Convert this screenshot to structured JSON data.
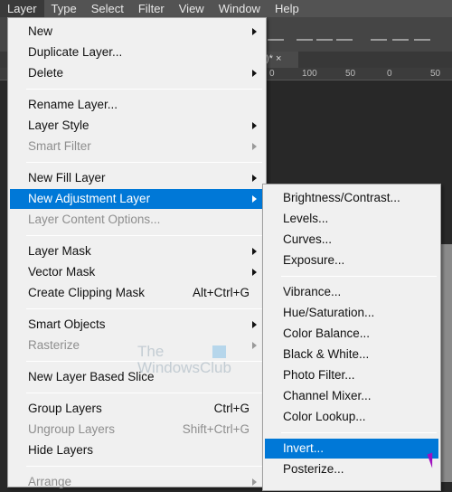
{
  "menubar": [
    "Layer",
    "Type",
    "Select",
    "Filter",
    "View",
    "Window",
    "Help"
  ],
  "document_tab": {
    "label": ")*",
    "close": "×"
  },
  "ruler": [
    "0",
    "100",
    "50",
    "0",
    "50"
  ],
  "main_menu": [
    {
      "label": "New",
      "arrow": true
    },
    {
      "label": "Duplicate Layer..."
    },
    {
      "label": "Delete",
      "arrow": true
    },
    {
      "sep": true
    },
    {
      "label": "Rename Layer..."
    },
    {
      "label": "Layer Style",
      "arrow": true
    },
    {
      "label": "Smart Filter",
      "arrow": true,
      "disabled": true
    },
    {
      "sep": true
    },
    {
      "label": "New Fill Layer",
      "arrow": true
    },
    {
      "label": "New Adjustment Layer",
      "arrow": true,
      "highlighted": true
    },
    {
      "label": "Layer Content Options...",
      "disabled": true
    },
    {
      "sep": true
    },
    {
      "label": "Layer Mask",
      "arrow": true
    },
    {
      "label": "Vector Mask",
      "arrow": true
    },
    {
      "label": "Create Clipping Mask",
      "shortcut": "Alt+Ctrl+G"
    },
    {
      "sep": true
    },
    {
      "label": "Smart Objects",
      "arrow": true
    },
    {
      "label": "Rasterize",
      "arrow": true,
      "disabled": true
    },
    {
      "sep": true
    },
    {
      "label": "New Layer Based Slice"
    },
    {
      "sep": true
    },
    {
      "label": "Group Layers",
      "shortcut": "Ctrl+G"
    },
    {
      "label": "Ungroup Layers",
      "shortcut": "Shift+Ctrl+G",
      "disabled": true
    },
    {
      "label": "Hide Layers"
    },
    {
      "sep": true
    },
    {
      "label": "Arrange",
      "arrow": true,
      "disabled": true
    }
  ],
  "sub_menu": [
    {
      "label": "Brightness/Contrast..."
    },
    {
      "label": "Levels..."
    },
    {
      "label": "Curves..."
    },
    {
      "label": "Exposure..."
    },
    {
      "sep": true
    },
    {
      "label": "Vibrance..."
    },
    {
      "label": "Hue/Saturation..."
    },
    {
      "label": "Color Balance..."
    },
    {
      "label": "Black & White..."
    },
    {
      "label": "Photo Filter..."
    },
    {
      "label": "Channel Mixer..."
    },
    {
      "label": "Color Lookup..."
    },
    {
      "sep": true
    },
    {
      "label": "Invert...",
      "highlighted": true
    },
    {
      "label": "Posterize..."
    }
  ],
  "watermark": {
    "line1": "The",
    "line2": "WindowsClub"
  },
  "colors": {
    "highlight": "#0078d7",
    "menu_bg": "#f0f0f0",
    "menubar_bg": "#535353"
  }
}
